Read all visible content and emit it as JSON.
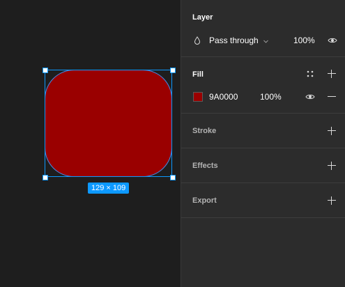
{
  "canvas": {
    "shape_color": "#9A0000",
    "dimensions_badge": "129 × 109",
    "selection_color": "#0D99FF"
  },
  "layer": {
    "title": "Layer",
    "blend_mode": "Pass through",
    "opacity": "100%"
  },
  "fill": {
    "title": "Fill",
    "hex": "9A0000",
    "opacity": "100%",
    "swatch_color": "#9A0000"
  },
  "stroke": {
    "title": "Stroke"
  },
  "effects": {
    "title": "Effects"
  },
  "export": {
    "title": "Export"
  },
  "icons": [
    "drop-icon",
    "chevron-down-icon",
    "eye-icon",
    "styles-grid-icon",
    "plus-icon",
    "minus-icon"
  ]
}
